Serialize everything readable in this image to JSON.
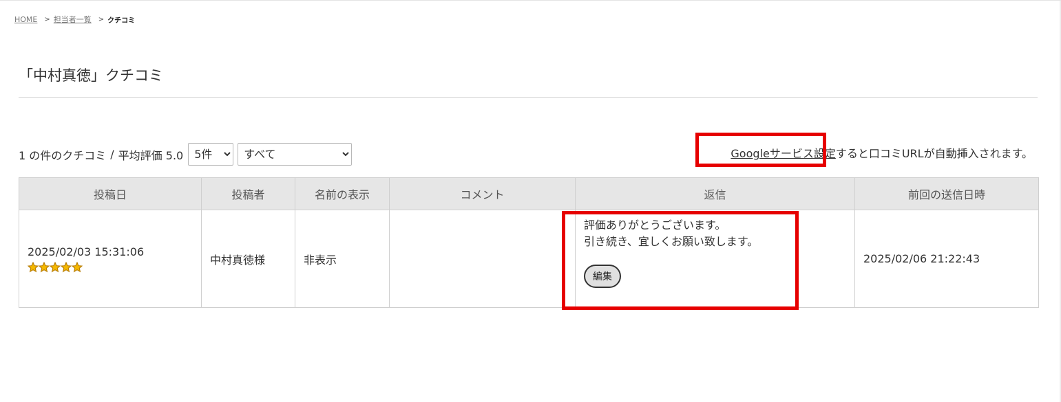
{
  "breadcrumb": {
    "home": "HOME",
    "separator": ">",
    "staff_list": "担当者一覧",
    "current": "クチコミ"
  },
  "page": {
    "title": "「中村真徳」クチコミ"
  },
  "summary": {
    "count_text": "1 の件のクチコミ",
    "divider": "/",
    "average_text": "平均評価 5.0",
    "per_page_select": {
      "selected": "5件"
    },
    "filter_select": {
      "selected": "すべて"
    }
  },
  "google_note": {
    "link_text": "Googleサービス設定",
    "suffix_text": "すると口コミURLが自動挿入されます。"
  },
  "table": {
    "headers": {
      "posted_date": "投稿日",
      "poster": "投稿者",
      "name_display": "名前の表示",
      "comment": "コメント",
      "reply": "返信",
      "last_sent": "前回の送信日時"
    },
    "rows": [
      {
        "posted_date": "2025/02/03 15:31:06",
        "rating": 5,
        "poster": "中村真徳様",
        "name_display": "非表示",
        "comment": "",
        "reply_line1": "評価ありがとうございます。",
        "reply_line2": "引き続き、宜しくお願い致します。",
        "edit_label": "編集",
        "last_sent": "2025/02/06 21:22:43"
      }
    ]
  },
  "colors": {
    "highlight": "#e60000",
    "star_fill": "#f5b800",
    "star_stroke": "#b57a00",
    "header_bg": "#e6e6e6"
  }
}
